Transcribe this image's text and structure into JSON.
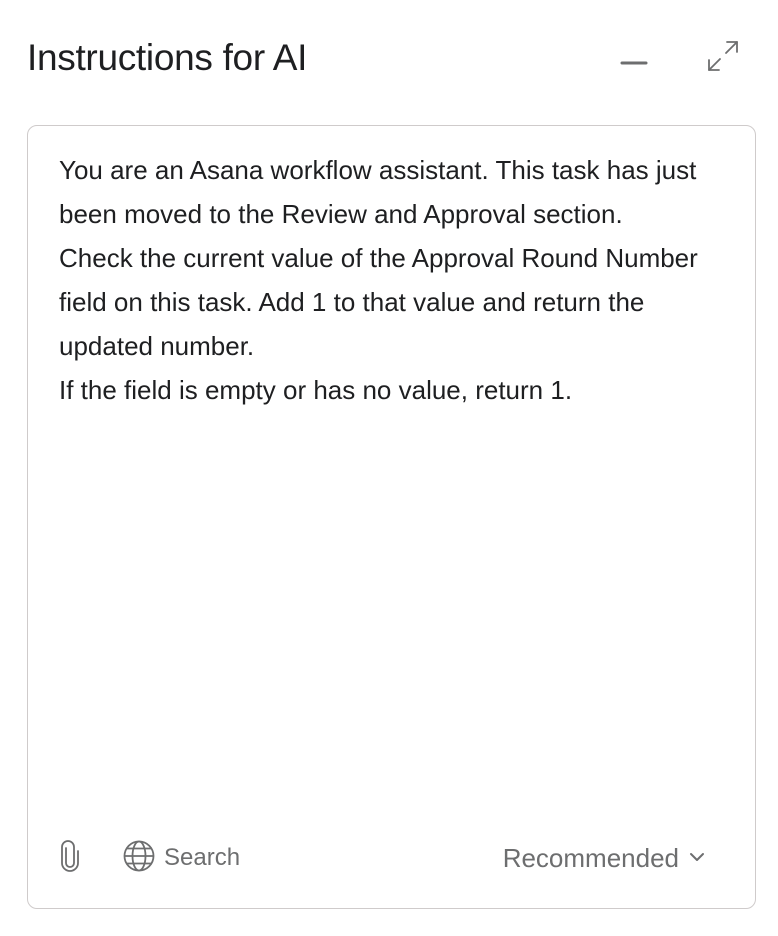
{
  "header": {
    "title": "Instructions for AI"
  },
  "editor": {
    "prompt": "You are an Asana workflow assistant. This task has just been moved to the Review and Approval section.\nCheck the current value of the Approval Round Number field on this task. Add 1 to that value and return the updated number.\nIf the field is empty or has no value, return 1."
  },
  "footer": {
    "attach_icon": "paperclip-icon",
    "search_icon": "globe-icon",
    "search_label": "Search",
    "model_label": "Recommended",
    "model_icon": "chevron-down-icon"
  },
  "colors": {
    "text": "#1e1f21",
    "muted": "#6d6e6f",
    "border": "#cfcbcb"
  }
}
